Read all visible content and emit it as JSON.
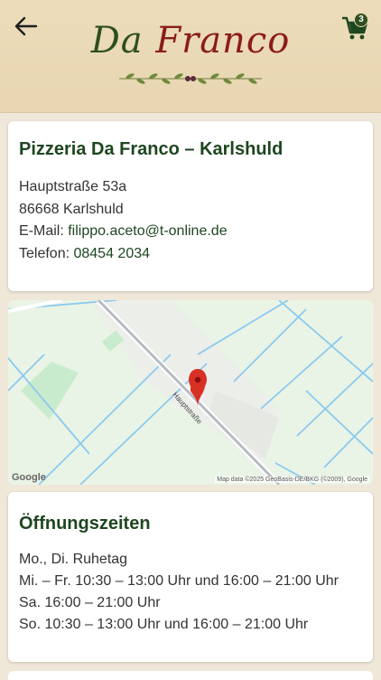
{
  "header": {
    "logo_part1": "Da",
    "logo_part2": "Franco",
    "cart_count": "3"
  },
  "info_card": {
    "title": "Pizzeria Da Franco – Karlshuld",
    "street": "Hauptstraße 53a",
    "city": "86668 Karlshuld",
    "email_label": "E-Mail: ",
    "email": "filippo.aceto@t-online.de",
    "phone_label": "Telefon: ",
    "phone": "08454 2034"
  },
  "map": {
    "street_label": "Hauptstraße",
    "google_logo": "Google",
    "attribution": "Map data ©2025 GeoBasis-DE/BKG (©2009), Google"
  },
  "hours_card": {
    "title": "Öffnungszeiten",
    "lines": [
      "Mo., Di. Ruhetag",
      "Mi. – Fr. 10:30 – 13:00 Uhr und 16:00 – 21:00 Uhr",
      "Sa. 16:00 – 21:00 Uhr",
      "So. 10:30 – 13:00 Uhr und 16:00 – 21:00 Uhr"
    ]
  },
  "colors": {
    "accent": "#1e4620",
    "header_bg": "#e8d6b1",
    "page_bg": "#efe7d8",
    "marker": "#d93025"
  },
  "icons": [
    "back-arrow-icon",
    "cart-icon",
    "map-marker-icon",
    "olive-branch-icon"
  ]
}
